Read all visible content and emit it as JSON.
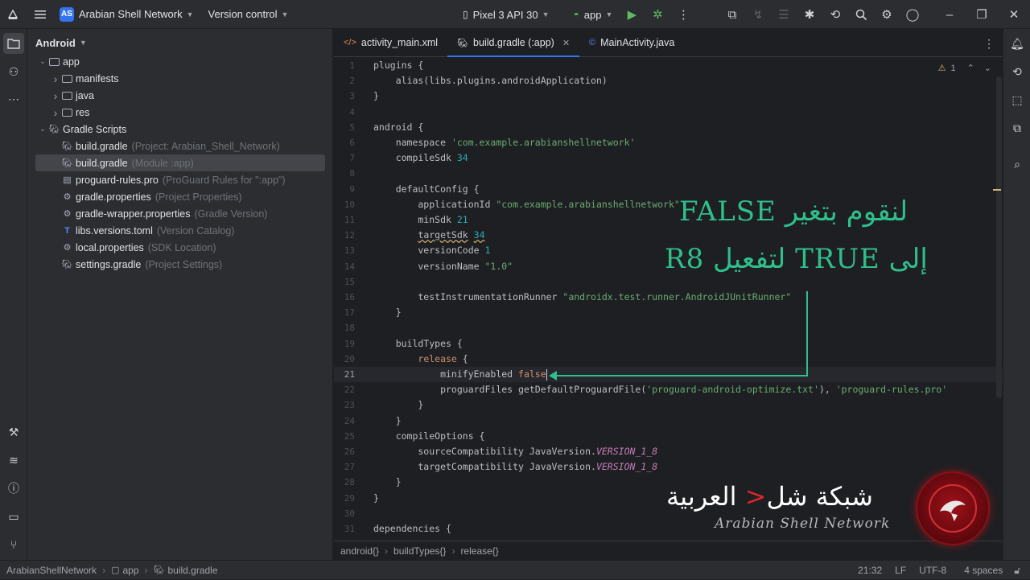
{
  "titlebar": {
    "project_badge": "AS",
    "project_name": "Arabian Shell Network",
    "vcs": "Version control",
    "device": "Pixel 3 API 30",
    "run_config": "app"
  },
  "project_panel": {
    "view": "Android",
    "tree": [
      {
        "label": "app",
        "hint": "",
        "depth": 1,
        "kind": "folder",
        "expanded": true
      },
      {
        "label": "manifests",
        "hint": "",
        "depth": 2,
        "kind": "folder",
        "expanded": false
      },
      {
        "label": "java",
        "hint": "",
        "depth": 2,
        "kind": "folder",
        "expanded": false
      },
      {
        "label": "res",
        "hint": "",
        "depth": 2,
        "kind": "folder",
        "expanded": false
      },
      {
        "label": "Gradle Scripts",
        "hint": "",
        "depth": 1,
        "kind": "gradle",
        "expanded": true
      },
      {
        "label": "build.gradle",
        "hint": "(Project: Arabian_Shell_Network)",
        "depth": 2,
        "kind": "gradle"
      },
      {
        "label": "build.gradle",
        "hint": "(Module :app)",
        "depth": 2,
        "kind": "gradle",
        "selected": true
      },
      {
        "label": "proguard-rules.pro",
        "hint": "(ProGuard Rules for \":app\")",
        "depth": 2,
        "kind": "file"
      },
      {
        "label": "gradle.properties",
        "hint": "(Project Properties)",
        "depth": 2,
        "kind": "settings"
      },
      {
        "label": "gradle-wrapper.properties",
        "hint": "(Gradle Version)",
        "depth": 2,
        "kind": "settings"
      },
      {
        "label": "libs.versions.toml",
        "hint": "(Version Catalog)",
        "depth": 2,
        "kind": "toml"
      },
      {
        "label": "local.properties",
        "hint": "(SDK Location)",
        "depth": 2,
        "kind": "settings"
      },
      {
        "label": "settings.gradle",
        "hint": "(Project Settings)",
        "depth": 2,
        "kind": "gradle"
      }
    ]
  },
  "tabs": [
    {
      "label": "activity_main.xml",
      "icon": "xml-icon",
      "active": false
    },
    {
      "label": "build.gradle (:app)",
      "icon": "gradle-icon",
      "active": true,
      "closable": true
    },
    {
      "label": "MainActivity.java",
      "icon": "java-class-icon",
      "active": false
    }
  ],
  "inspection": {
    "warnings": "1"
  },
  "code_lines": [
    [
      {
        "t": "plugins {"
      }
    ],
    [
      {
        "t": "    alias(libs.plugins.androidApplication)"
      }
    ],
    [
      {
        "t": "}"
      }
    ],
    [
      {
        "t": ""
      }
    ],
    [
      {
        "t": "android {"
      }
    ],
    [
      {
        "t": "    namespace "
      },
      {
        "t": "'com.example.arabianshellnetwork'",
        "c": "str"
      }
    ],
    [
      {
        "t": "    compileSdk "
      },
      {
        "t": "34",
        "c": "num"
      }
    ],
    [
      {
        "t": ""
      }
    ],
    [
      {
        "t": "    defaultConfig {"
      }
    ],
    [
      {
        "t": "        applicationId "
      },
      {
        "t": "\"com.example.arabianshellnetwork\"",
        "c": "str"
      }
    ],
    [
      {
        "t": "        minSdk "
      },
      {
        "t": "21",
        "c": "num"
      }
    ],
    [
      {
        "t": "        "
      },
      {
        "t": "targetSdk",
        "c": "warnu"
      },
      {
        "t": " "
      },
      {
        "t": "34",
        "c": "num warnu"
      }
    ],
    [
      {
        "t": "        versionCode "
      },
      {
        "t": "1",
        "c": "num"
      }
    ],
    [
      {
        "t": "        versionName "
      },
      {
        "t": "\"1.0\"",
        "c": "str"
      }
    ],
    [
      {
        "t": ""
      }
    ],
    [
      {
        "t": "        testInstrumentationRunner "
      },
      {
        "t": "\"androidx.test.runner.AndroidJUnitRunner\"",
        "c": "str"
      }
    ],
    [
      {
        "t": "    }"
      }
    ],
    [
      {
        "t": ""
      }
    ],
    [
      {
        "t": "    buildTypes {"
      }
    ],
    [
      {
        "t": "        "
      },
      {
        "t": "release",
        "c": "kw"
      },
      {
        "t": " {"
      }
    ],
    [
      {
        "t": "            minifyEnabled "
      },
      {
        "t": "false",
        "c": "kw"
      }
    ],
    [
      {
        "t": "            proguardFiles getDefaultProguardFile("
      },
      {
        "t": "'proguard-android-optimize.txt'",
        "c": "str"
      },
      {
        "t": "), "
      },
      {
        "t": "'proguard-rules.pro'",
        "c": "str"
      }
    ],
    [
      {
        "t": "        }"
      }
    ],
    [
      {
        "t": "    }"
      }
    ],
    [
      {
        "t": "    compileOptions {"
      }
    ],
    [
      {
        "t": "        sourceCompatibility JavaVersion."
      },
      {
        "t": "VERSION_1_8",
        "c": "cst"
      }
    ],
    [
      {
        "t": "        targetCompatibility JavaVersion."
      },
      {
        "t": "VERSION_1_8",
        "c": "cst"
      }
    ],
    [
      {
        "t": "    }"
      }
    ],
    [
      {
        "t": "}"
      }
    ],
    [
      {
        "t": ""
      }
    ],
    [
      {
        "t": "dependencies {"
      }
    ]
  ],
  "current_line": 21,
  "breadcrumb": [
    "android{}",
    "buildTypes{}",
    "release{}"
  ],
  "statusbar": {
    "path": [
      "ArabianShellNetwork",
      "app",
      "build.gradle"
    ],
    "position": "21:32",
    "line_sep": "LF",
    "encoding": "UTF-8",
    "indent": "4 spaces"
  },
  "annotation": {
    "line1": "لنقوم بتغير FALSE",
    "line2": "إلى TRUE لتفعيل R8"
  },
  "watermark": {
    "arabic_a": "شبكة شل",
    "arabic_lt": "<",
    "arabic_b": " العربية",
    "english": "Arabian Shell Network"
  },
  "colors": {
    "accent": "#3574f0",
    "annotation": "#2fbf8c",
    "logo_red": "#e0262b"
  }
}
